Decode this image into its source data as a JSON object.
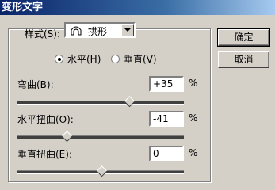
{
  "window": {
    "title": "变形文字"
  },
  "group": {
    "style_label": "样式(S):",
    "style_value": "拱形",
    "style_icon": "arch-icon"
  },
  "orientation": {
    "horizontal_label": "水平(H)",
    "vertical_label": "垂直(V)",
    "selected": "horizontal"
  },
  "bend": {
    "label": "弯曲(B):",
    "value": "+35",
    "unit": "%",
    "level": 0.675
  },
  "hdist": {
    "label": "水平扭曲(O):",
    "value": "-41",
    "unit": "%",
    "level": 0.295
  },
  "vdist": {
    "label": "垂直扭曲(E):",
    "value": "0",
    "unit": "%",
    "level": 0.5
  },
  "buttons": {
    "ok": "确定",
    "cancel": "取消"
  }
}
